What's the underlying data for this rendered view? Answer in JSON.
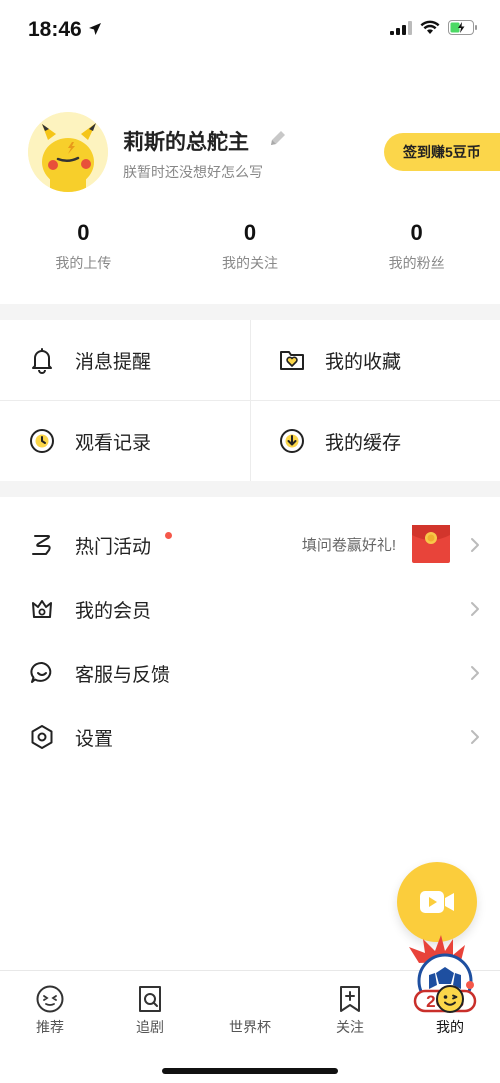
{
  "status_bar": {
    "time": "18:46"
  },
  "profile": {
    "username": "莉斯的总舵主",
    "bio": "朕暂时还没想好怎么写",
    "checkin_label": "签到赚5豆币"
  },
  "stats": [
    {
      "value": "0",
      "label": "我的上传"
    },
    {
      "value": "0",
      "label": "我的关注"
    },
    {
      "value": "0",
      "label": "我的粉丝"
    }
  ],
  "grid": [
    {
      "label": "消息提醒",
      "icon": "bell-icon"
    },
    {
      "label": "我的收藏",
      "icon": "heart-folder-icon"
    },
    {
      "label": "观看记录",
      "icon": "clock-icon"
    },
    {
      "label": "我的缓存",
      "icon": "download-icon"
    }
  ],
  "list": [
    {
      "label": "热门活动",
      "icon": "activity-icon",
      "promo": "填问卷赢好礼!"
    },
    {
      "label": "我的会员",
      "icon": "crown-icon"
    },
    {
      "label": "客服与反馈",
      "icon": "chat-icon"
    },
    {
      "label": "设置",
      "icon": "settings-hex-icon"
    }
  ],
  "tabbar": {
    "tabs": [
      {
        "label": "推荐",
        "icon": "recommend-icon"
      },
      {
        "label": "追剧",
        "icon": "follow-drama-icon"
      },
      {
        "label": "世界杯",
        "icon": "worldcup-icon"
      },
      {
        "label": "关注",
        "icon": "follow-icon"
      },
      {
        "label": "我的",
        "icon": "me-icon"
      }
    ],
    "worldcup_year": "2018"
  },
  "colors": {
    "accent": "#fbd64a",
    "fab": "#fbcd3c",
    "red_dot": "#f5584a",
    "gap_bg": "#f4f4f4"
  }
}
